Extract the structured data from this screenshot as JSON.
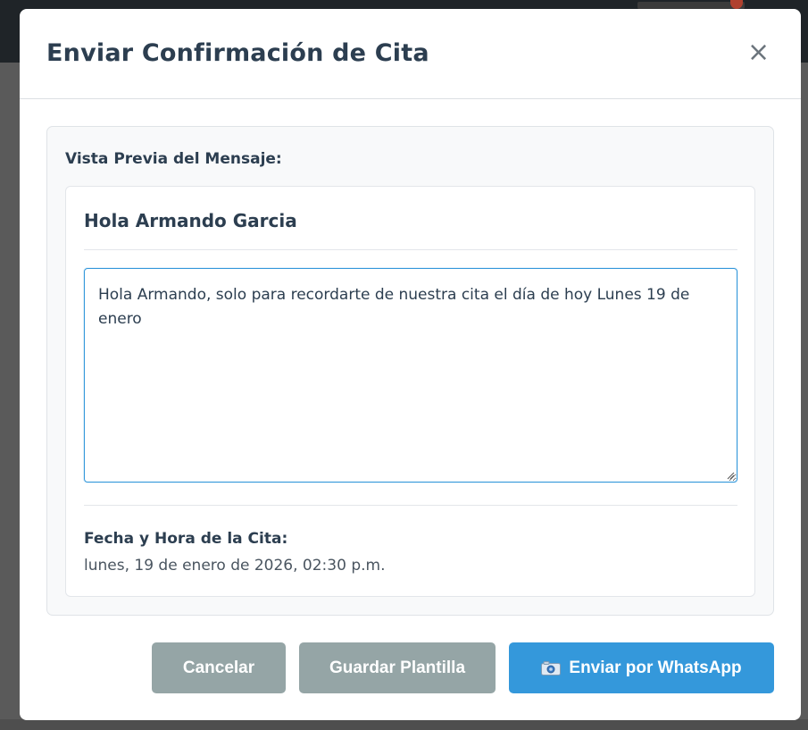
{
  "modal": {
    "title": "Enviar Confirmación de Cita",
    "close_symbol": "×"
  },
  "preview": {
    "label": "Vista Previa del Mensaje:",
    "greeting": "Hola Armando Garcia",
    "message": "Hola Armando, solo para recordarte de nuestra cita el día de hoy Lunes 19 de enero",
    "date_label": "Fecha y Hora de la Cita:",
    "date_value": "lunes, 19 de enero de 2026, 02:30 p.m."
  },
  "actions": {
    "cancel_label": "Cancelar",
    "save_template_label": "Guardar Plantilla",
    "send_whatsapp_label": "Enviar por WhatsApp",
    "send_icon": "camera-icon"
  },
  "colors": {
    "primary": "#3498db",
    "secondary": "#95a5a6",
    "title_text": "#2c3e50"
  }
}
